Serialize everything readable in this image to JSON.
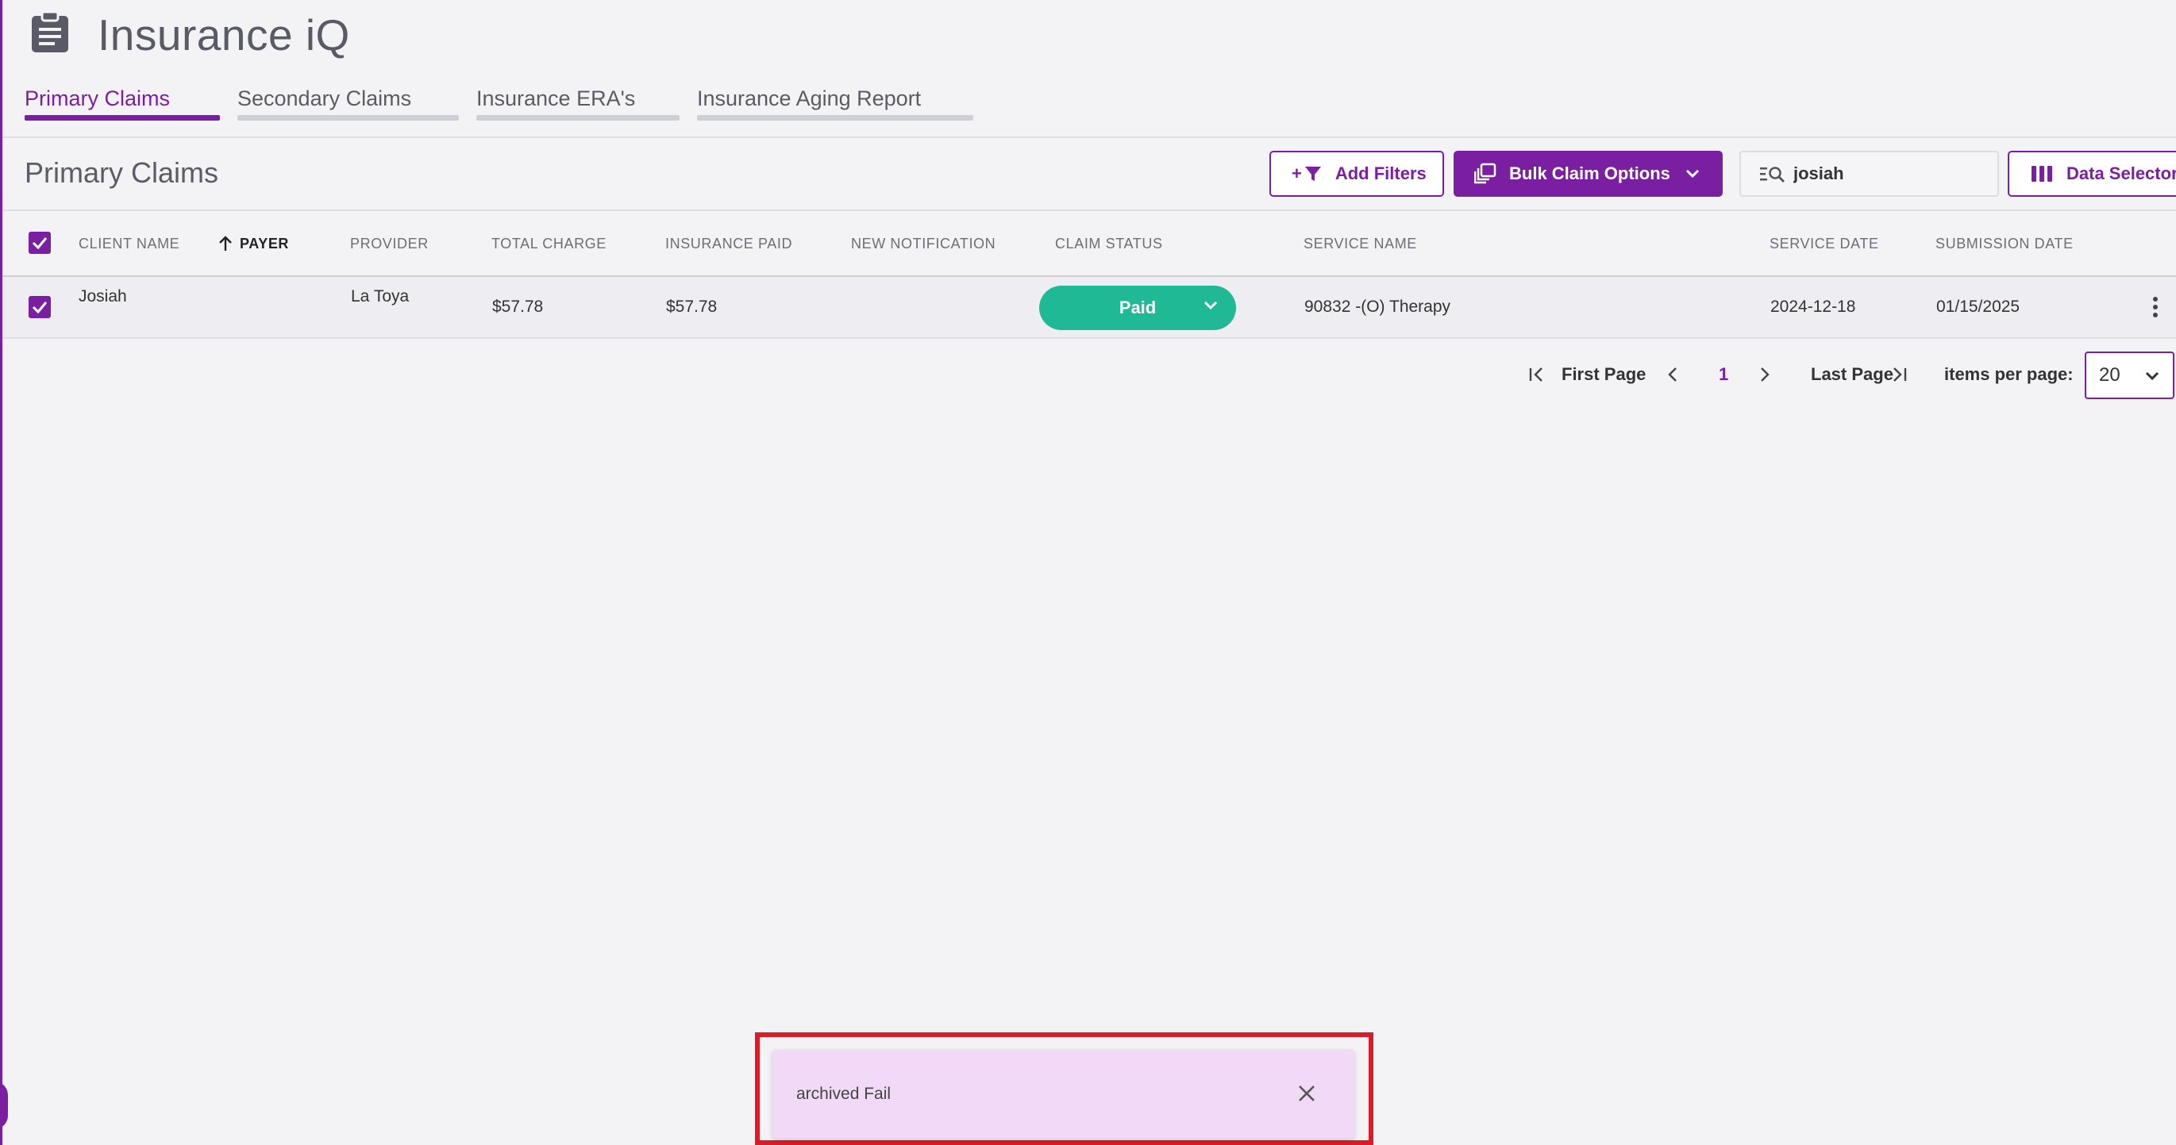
{
  "app": {
    "title": "Insurance iQ",
    "icon": "clipboard-icon"
  },
  "tabs": [
    {
      "label": "Primary Claims",
      "active": true
    },
    {
      "label": "Secondary Claims",
      "active": false
    },
    {
      "label": "Insurance ERA's",
      "active": false
    },
    {
      "label": "Insurance Aging Report",
      "active": false
    }
  ],
  "section": {
    "title": "Primary Claims"
  },
  "toolbar": {
    "add_filters_label": "Add Filters",
    "add_filters_prefix": "+",
    "bulk_label": "Bulk Claim Options",
    "search_value": "josiah",
    "data_selector_label": "Data Selector"
  },
  "table": {
    "columns": [
      "CLIENT NAME",
      "PAYER",
      "PROVIDER",
      "TOTAL CHARGE",
      "INSURANCE PAID",
      "NEW NOTIFICATION",
      "CLAIM STATUS",
      "SERVICE NAME",
      "SERVICE DATE",
      "SUBMISSION DATE"
    ],
    "sort_column": "PAYER",
    "rows": [
      {
        "client_name": "Josiah",
        "payer": "",
        "provider": "La Toya",
        "total_charge": "$57.78",
        "insurance_paid": "$57.78",
        "new_notification": "",
        "claim_status": "Paid",
        "service_name": "90832 -(O) Therapy",
        "service_date": "2024-12-18",
        "submission_date": "01/15/2025",
        "selected": true
      }
    ]
  },
  "pagination": {
    "first_label": "First Page",
    "current_page": "1",
    "last_label": "Last Page",
    "items_per_page_label": "items per page:",
    "items_per_page_value": "20"
  },
  "snackbar": {
    "message": "archived Fail"
  },
  "colors": {
    "accent": "#7b1fa2",
    "status_paid": "#1fb995",
    "snackbar_bg": "#f3d9f8",
    "highlight": "#d91c27"
  }
}
